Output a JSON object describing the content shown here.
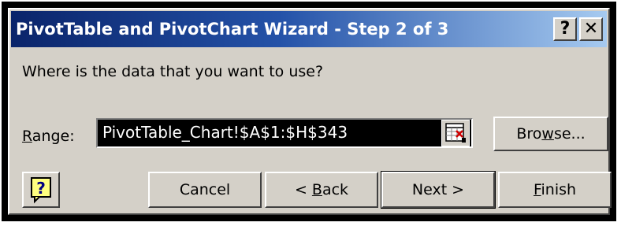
{
  "dialog": {
    "title": "PivotTable and PivotChart Wizard - Step 2 of 3",
    "title_help": "?",
    "title_close": "✕",
    "prompt": "Where is the data that you want to use?"
  },
  "range": {
    "label_prefix": "",
    "label_mnemonic": "R",
    "label_suffix": "ange:",
    "value": "PivotTable_Chart!$A$1:$H$343"
  },
  "buttons": {
    "browse_prefix": "Bro",
    "browse_mnemonic": "w",
    "browse_suffix": "se...",
    "cancel": "Cancel",
    "back_prefix": "< ",
    "back_mnemonic": "B",
    "back_suffix": "ack",
    "next": "Next >",
    "finish_prefix": "",
    "finish_mnemonic": "F",
    "finish_suffix": "inish"
  },
  "icons": {
    "help_icon": "question-mark-icon",
    "collapse_icon": "collapse-dialog-icon"
  },
  "colors": {
    "title_start": "#0a246a",
    "title_end": "#a6caf0",
    "dialog_face": "#d4d0c8",
    "input_selected_bg": "#000000"
  }
}
